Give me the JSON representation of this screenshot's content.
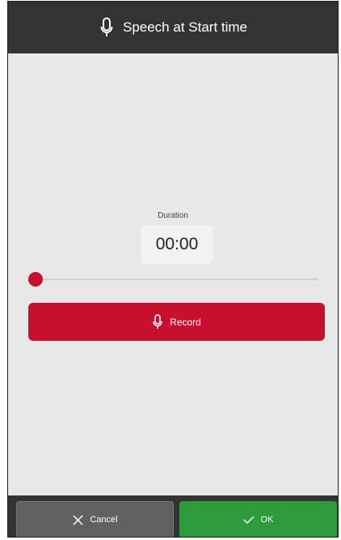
{
  "dialog": {
    "title": "Speech at Start time",
    "title_icon": "microphone-icon"
  },
  "duration": {
    "label": "Duration",
    "value": "00:00",
    "progress": 0
  },
  "record_button": {
    "label": "Record",
    "icon": "microphone-icon"
  },
  "footer": {
    "cancel_label": "Cancel",
    "cancel_icon": "close-icon",
    "ok_label": "OK",
    "ok_icon": "check-icon"
  },
  "colors": {
    "header_bg": "#333333",
    "content_bg": "#e8e8e8",
    "accent_red": "#c8102e",
    "ok_green": "#2e9b3b",
    "cancel_gray": "#616161"
  }
}
